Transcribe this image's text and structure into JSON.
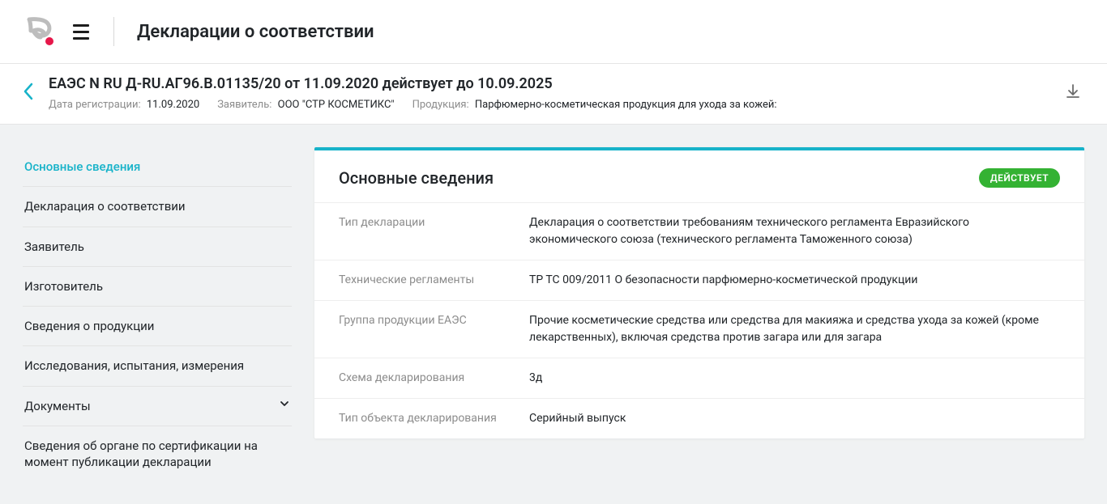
{
  "header": {
    "page_title": "Декларации о соответствии"
  },
  "subheader": {
    "doc_title": "ЕАЭС N RU Д-RU.АГ96.В.01135/20 от 11.09.2020 действует до 10.09.2025",
    "reg_label": "Дата регистрации:",
    "reg_value": "11.09.2020",
    "applicant_label": "Заявитель:",
    "applicant_value": "ООО \"СТР КОСМЕТИКС\"",
    "product_label": "Продукция:",
    "product_value": "Парфюмерно-косметическая продукция для ухода за кожей:"
  },
  "sidebar": {
    "items": [
      {
        "label": "Основные сведения"
      },
      {
        "label": "Декларация о соответствии"
      },
      {
        "label": "Заявитель"
      },
      {
        "label": "Изготовитель"
      },
      {
        "label": "Сведения о продукции"
      },
      {
        "label": "Исследования, испытания, измерения"
      },
      {
        "label": "Документы"
      },
      {
        "label": "Сведения об органе по сертификации на момент публикации декларации"
      }
    ]
  },
  "card": {
    "title": "Основные сведения",
    "status": "ДЕЙСТВУЕТ",
    "rows": [
      {
        "label": "Тип декларации",
        "value": "Декларация о соответствии требованиям технического регламента Евразийского экономического союза (технического регламента Таможенного союза)"
      },
      {
        "label": "Технические регламенты",
        "value": "ТР ТС 009/2011 О безопасности парфюмерно-косметической продукции"
      },
      {
        "label": "Группа продукции ЕАЭС",
        "value": "Прочие косметические средства или средства для макияжа и средства ухода за кожей (кроме лекарственных), включая средства против загара или для загара"
      },
      {
        "label": "Схема декларирования",
        "value": "3д"
      },
      {
        "label": "Тип объекта декларирования",
        "value": "Серийный выпуск"
      }
    ]
  }
}
